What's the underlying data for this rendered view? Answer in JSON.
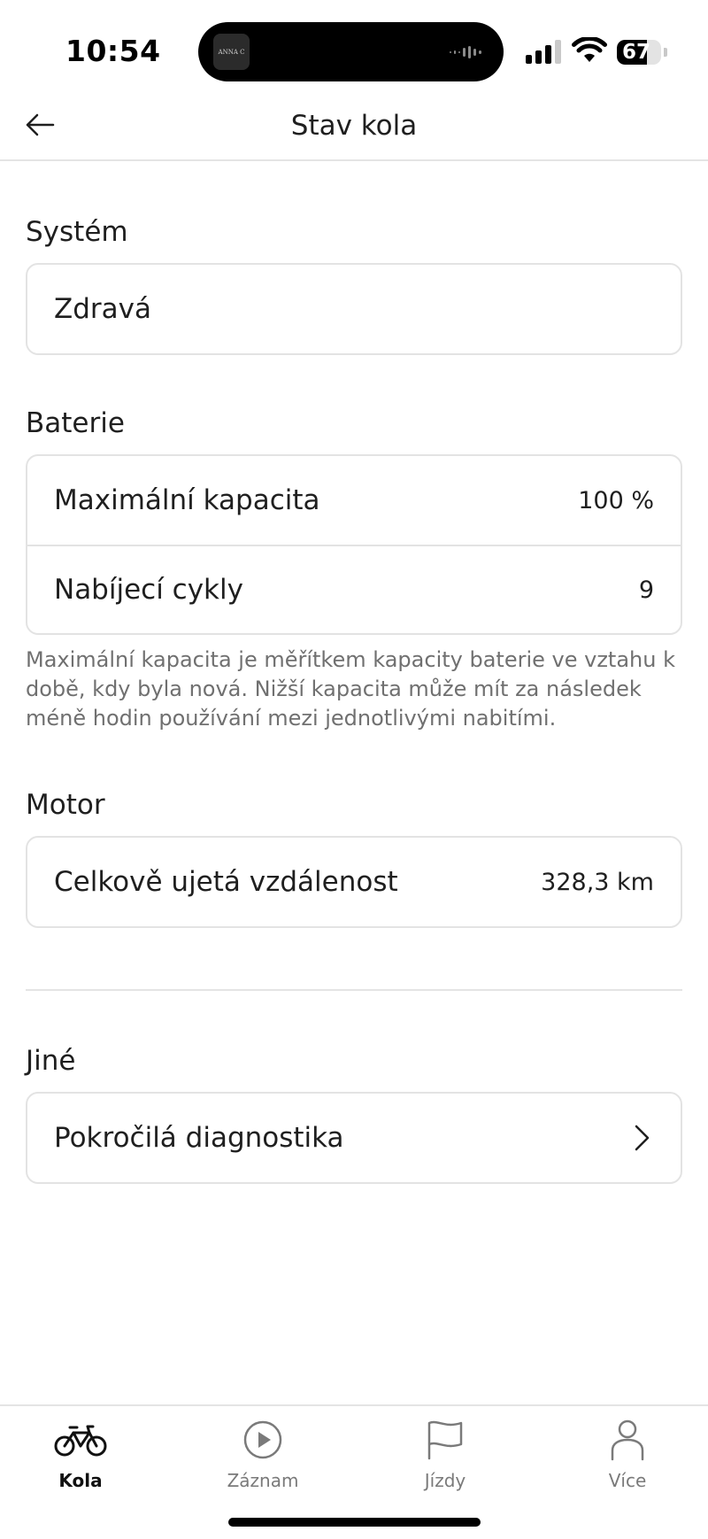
{
  "status_bar": {
    "time": "10:54",
    "island_thumb_text": "ANNA C",
    "battery_level": "67",
    "battery_fraction": 0.67
  },
  "header": {
    "title": "Stav kola",
    "back_icon": "arrow-left-icon"
  },
  "sections": {
    "system": {
      "title": "Systém",
      "status": "Zdravá"
    },
    "battery": {
      "title": "Baterie",
      "rows": [
        {
          "label": "Maximální kapacita",
          "value": "100 %"
        },
        {
          "label": "Nabíjecí cykly",
          "value": "9"
        }
      ],
      "note": "Maximální kapacita je měřítkem kapacity baterie ve vztahu k době, kdy byla nová. Nižší kapacita může mít za následek méně hodin používání mezi jednotlivými nabitími."
    },
    "motor": {
      "title": "Motor",
      "rows": [
        {
          "label": "Celkově ujetá vzdálenost",
          "value": "328,3 km"
        }
      ]
    },
    "other": {
      "title": "Jiné",
      "rows": [
        {
          "label": "Pokročilá diagnostika",
          "icon": "chevron-right-icon"
        }
      ]
    }
  },
  "tab_bar": {
    "items": [
      {
        "label": "Kola",
        "icon": "bicycle-icon",
        "active": true
      },
      {
        "label": "Záznam",
        "icon": "play-circle-icon",
        "active": false
      },
      {
        "label": "Jízdy",
        "icon": "flag-icon",
        "active": false
      },
      {
        "label": "Více",
        "icon": "person-icon",
        "active": false
      }
    ]
  },
  "colors": {
    "text": "#1f1f1f",
    "muted": "#707070",
    "border": "#e3e3e3",
    "inactive_tab": "#7a7a7a"
  }
}
